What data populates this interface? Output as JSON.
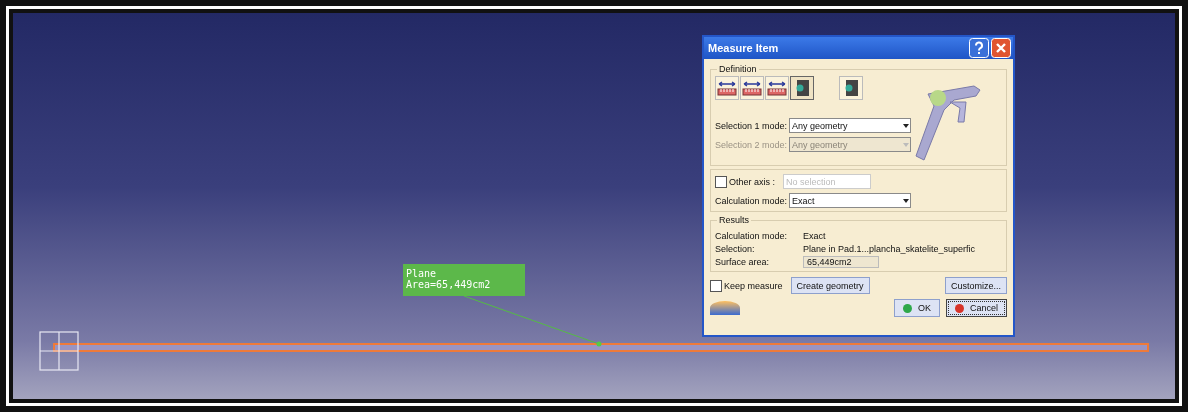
{
  "viewport": {
    "annotation": {
      "lines": [
        "Plane",
        "Area=65,449cm2"
      ]
    }
  },
  "dialog": {
    "title": "Measure Item",
    "definition": {
      "legend": "Definition",
      "tools": [
        {
          "selected": false
        },
        {
          "selected": false
        },
        {
          "selected": false
        },
        {
          "selected": true
        },
        {
          "selected": false
        }
      ],
      "selection_1": {
        "label": "Selection 1 mode:",
        "value": "Any geometry",
        "disabled": false
      },
      "selection_2": {
        "label": "Selection 2 mode:",
        "value": "Any geometry",
        "disabled": true
      }
    },
    "other_axis": {
      "label": "Other axis :",
      "checked": false,
      "placeholder": "No selection"
    },
    "calculation_mode": {
      "label": "Calculation mode:",
      "value": "Exact"
    },
    "results": {
      "legend": "Results",
      "rows": [
        {
          "kind": "text",
          "label": "Calculation mode:",
          "value": "Exact"
        },
        {
          "kind": "text",
          "label": "Selection:",
          "value": "Plane in Pad.1...plancha_skatelite_superfic"
        },
        {
          "kind": "field",
          "label": "Surface area:",
          "value": "65,449cm2"
        }
      ]
    },
    "keep_measure": {
      "label": "Keep measure",
      "checked": false
    },
    "create_geometry": "Create geometry",
    "customize": "Customize...",
    "buttons": [
      {
        "kind": "ok",
        "label": "OK"
      },
      {
        "kind": "cancel",
        "label": "Cancel"
      }
    ]
  }
}
